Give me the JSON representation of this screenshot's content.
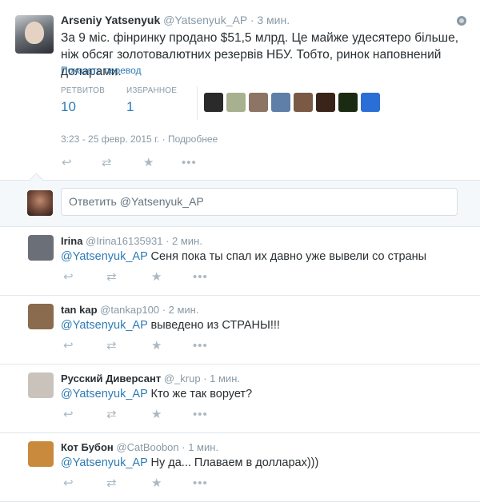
{
  "main_tweet": {
    "fullname": "Arseniy Yatsenyuk",
    "username": "@Yatsenyuk_AP",
    "time_ago": "3 мин.",
    "text": "За 9 міс. фінринку продано $51,5 млрд. Це майже удесятеро більше, ніж обсяг золотовалютних резервів НБУ. Тобто, ринок наповнений доларами.",
    "translate_link": "Показать перевод",
    "retweets_label": "РЕТВИТОВ",
    "retweets_count": "10",
    "favorites_label": "ИЗБРАННОЕ",
    "favorites_count": "1",
    "timestamp": "3:23 - 25 февр. 2015 г.",
    "details_link": "Подробнее"
  },
  "favoriter_avatars": [
    {
      "name": "avatar-1",
      "color": "#2a2a2a"
    },
    {
      "name": "avatar-2",
      "color": "#a8b18f"
    },
    {
      "name": "avatar-3",
      "color": "#8c7564"
    },
    {
      "name": "avatar-4",
      "color": "#5f7fa8"
    },
    {
      "name": "avatar-5",
      "color": "#7a5a44"
    },
    {
      "name": "avatar-6",
      "color": "#3a241a"
    },
    {
      "name": "avatar-7",
      "color": "#1b2b12"
    },
    {
      "name": "avatar-8",
      "color": "#2b6fd6"
    }
  ],
  "reply_box": {
    "placeholder": "Ответить @Yatsenyuk_AP"
  },
  "replies": [
    {
      "fullname": "Irina",
      "username": "@Irina16135931",
      "time_ago": "2 мин.",
      "mention": "@Yatsenyuk_AP",
      "text": " Сеня пока ты спал их давно уже вывели со страны",
      "avatar_color": "#6b6f78"
    },
    {
      "fullname": "tan kap",
      "username": "@tankap100",
      "time_ago": "2 мин.",
      "mention": "@Yatsenyuk_AP",
      "text": " выведено из СТРАНЫ!!!",
      "avatar_color": "#8a6b4e"
    },
    {
      "fullname": "Русский Диверсант",
      "username": "@_krup",
      "time_ago": "1 мин.",
      "mention": "@Yatsenyuk_AP",
      "text": " Кто же так ворует?",
      "avatar_color": "#c9c3bb"
    },
    {
      "fullname": "Кот Бубон",
      "username": "@CatBoobon",
      "time_ago": "1 мин.",
      "mention": "@Yatsenyuk_AP",
      "text": " Ну да... Плаваем в долларах)))",
      "avatar_color": "#c98a3e"
    }
  ],
  "icons": {
    "reply": "reply-icon",
    "retweet": "retweet-icon",
    "favorite": "favorite-star-icon",
    "more": "more-dots-icon",
    "globe": "globe-icon"
  }
}
